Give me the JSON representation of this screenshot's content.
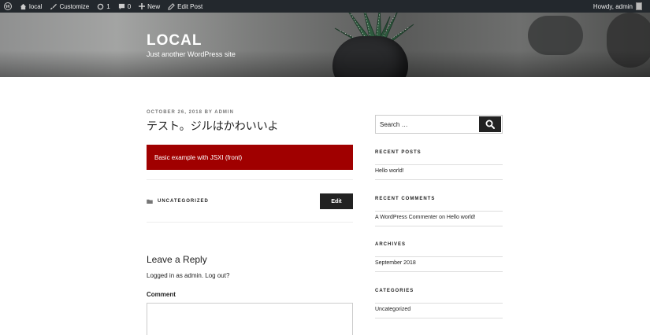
{
  "admin_bar": {
    "site_label": "local",
    "customize_label": "Customize",
    "updates_count": "1",
    "comments_count": "0",
    "new_label": "New",
    "edit_post_label": "Edit Post",
    "greeting": "Howdy, admin"
  },
  "header": {
    "site_title": "LOCAL",
    "tagline": "Just another WordPress site"
  },
  "post": {
    "meta": "OCTOBER 26, 2018 BY ADMIN",
    "title": "テスト。ジルはかわいいよ",
    "jsx_block_text": "Basic example with JSXI (front)",
    "category": "UNCATEGORIZED",
    "edit_label": "Edit"
  },
  "reply": {
    "title": "Leave a Reply",
    "logged_in_text": "Logged in as admin. Log out?",
    "comment_label": "Comment"
  },
  "sidebar": {
    "search_placeholder": "Search …",
    "recent_posts_title": "RECENT POSTS",
    "recent_posts": [
      "Hello world!"
    ],
    "recent_comments_title": "RECENT COMMENTS",
    "recent_comments": [
      "A WordPress Commenter on Hello world!"
    ],
    "archives_title": "ARCHIVES",
    "archives": [
      "September 2018"
    ],
    "categories_title": "CATEGORIES",
    "categories": [
      "Uncategorized"
    ]
  },
  "colors": {
    "admin_bar_bg": "#23282d",
    "jsx_block_bg": "#a00000",
    "button_bg": "#222222"
  }
}
